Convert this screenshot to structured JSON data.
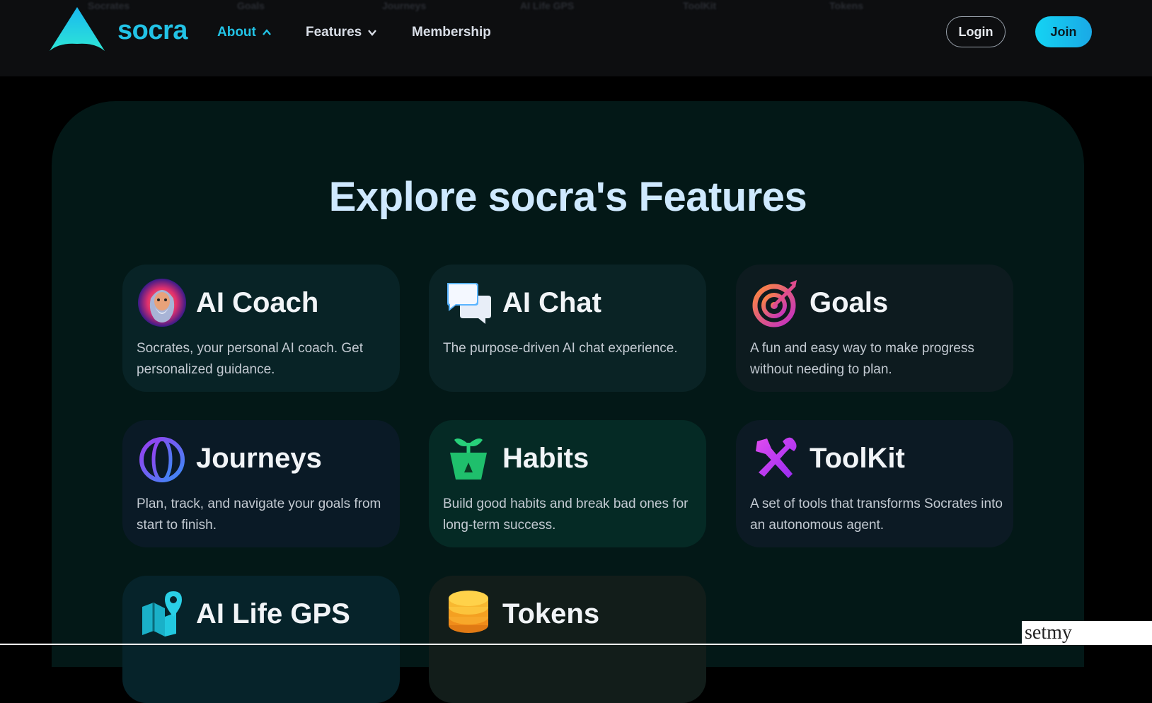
{
  "nav": {
    "ghost_links": [
      "Socrates",
      "Goals",
      "Journeys",
      "AI Life GPS",
      "ToolKit",
      "Tokens"
    ],
    "brand": "socra",
    "items": [
      {
        "label": "About",
        "active": true,
        "chevron": "chevron-up-icon"
      },
      {
        "label": "Features",
        "active": false,
        "chevron": "chevron-down-icon"
      },
      {
        "label": "Membership",
        "active": false
      }
    ],
    "login_label": "Login",
    "join_label": "Join"
  },
  "colors": {
    "accent": "#22c3e6",
    "join_gradient_start": "#14d3f3",
    "join_gradient_end": "#1aa9e6",
    "nav_bg": "#0d0e10",
    "panel_bg": "#031817",
    "heading": "#cfe9ff"
  },
  "main": {
    "heading": "Explore socra's Features",
    "cards": [
      {
        "title": "AI Coach",
        "icon": "socrates-avatar-icon",
        "desc": "Socrates, your personal AI coach. Get personalized guidance."
      },
      {
        "title": "AI Chat",
        "icon": "chat-bubbles-icon",
        "desc": "The purpose-driven AI chat experience."
      },
      {
        "title": "Goals",
        "icon": "target-icon",
        "desc": "A fun and easy way to make progress without needing to plan."
      },
      {
        "title": "Journeys",
        "icon": "globe-icon",
        "desc": "Plan, track, and navigate your goals from start to finish."
      },
      {
        "title": "Habits",
        "icon": "sprout-pot-icon",
        "desc": "Build good habits and break bad ones for long-term success."
      },
      {
        "title": "ToolKit",
        "icon": "crossed-tools-icon",
        "desc": "A set of tools that transforms Socrates into an autonomous agent."
      },
      {
        "title": "AI Life GPS",
        "icon": "map-pin-icon",
        "desc": ""
      },
      {
        "title": "Tokens",
        "icon": "coin-stack-icon",
        "desc": ""
      }
    ]
  },
  "watermark": "setmy"
}
